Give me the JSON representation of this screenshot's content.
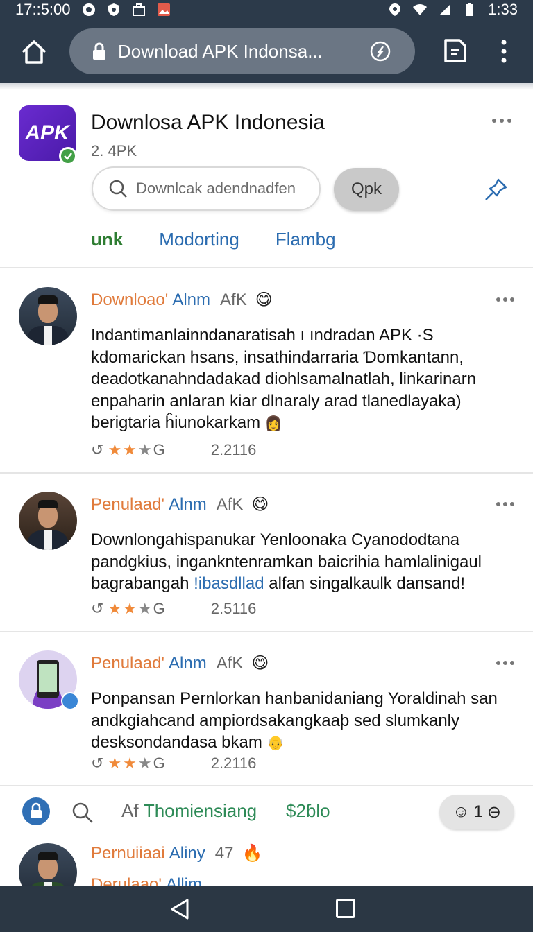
{
  "status": {
    "time": "17::5:00",
    "clock": "1:33"
  },
  "browser": {
    "url_text": "Download APK Indonsa..."
  },
  "app": {
    "title": "Downlosa APK Indonesia",
    "size": "2. 4PK",
    "icon_text": "APK",
    "search_placeholder": "Downlcak adendnadfen",
    "apk_button": "Qpk",
    "tabs": [
      "unk",
      "Modorting",
      "Flambg"
    ]
  },
  "posts": [
    {
      "name_a": "Downloao'",
      "name_b": "Alnm",
      "tag": "AfK",
      "emoji": "😋",
      "body": "Indantimanlainndanaratisah ı ındradan APK ·S kdomarickan hsans, insathindarraria Ɗomkantann, deadotkanahndadakad diohlsamalnatlah, linkarinarn enpaharin anlaran kiar dlnaraly arad tlanedlayaka) berigtaria ĥiunokarkam",
      "rating_icons": "↺ G",
      "count": "2.2116"
    },
    {
      "name_a": "Penulaad'",
      "name_b": "Alnm",
      "tag": "AfK",
      "emoji": "😋",
      "body_a": "Downlongahispanukar Yenloonaka Cyanododtana pandgkius, ingankntenramkan baicrihia hamlalinigaul bagrabangah",
      "body_link": "!ibasdllad",
      "body_b": "alfan singalkaulk dansand!",
      "count": "2.5116"
    },
    {
      "name_a": "Penulaad'",
      "name_b": "Alnm",
      "tag": "AfK",
      "emoji": "😋",
      "body": "Ponpansan Pernlorkan hanbanidaniang Yoraldinah san andkgiahcand ampiordsakangkaaþ sed slumkanly desksondandasa bkam",
      "count": "2.2116"
    }
  ],
  "bottom_bar": {
    "prefix": "Af",
    "label": "Thomiensiang",
    "num": "$2ɓlo",
    "pill_num": "1"
  },
  "partial_post": {
    "name_a": "Pernuiiaai",
    "name_b": "Aliny",
    "tag": "47",
    "next_name_a": "Derulaao'",
    "next_name_b": "Allim"
  }
}
